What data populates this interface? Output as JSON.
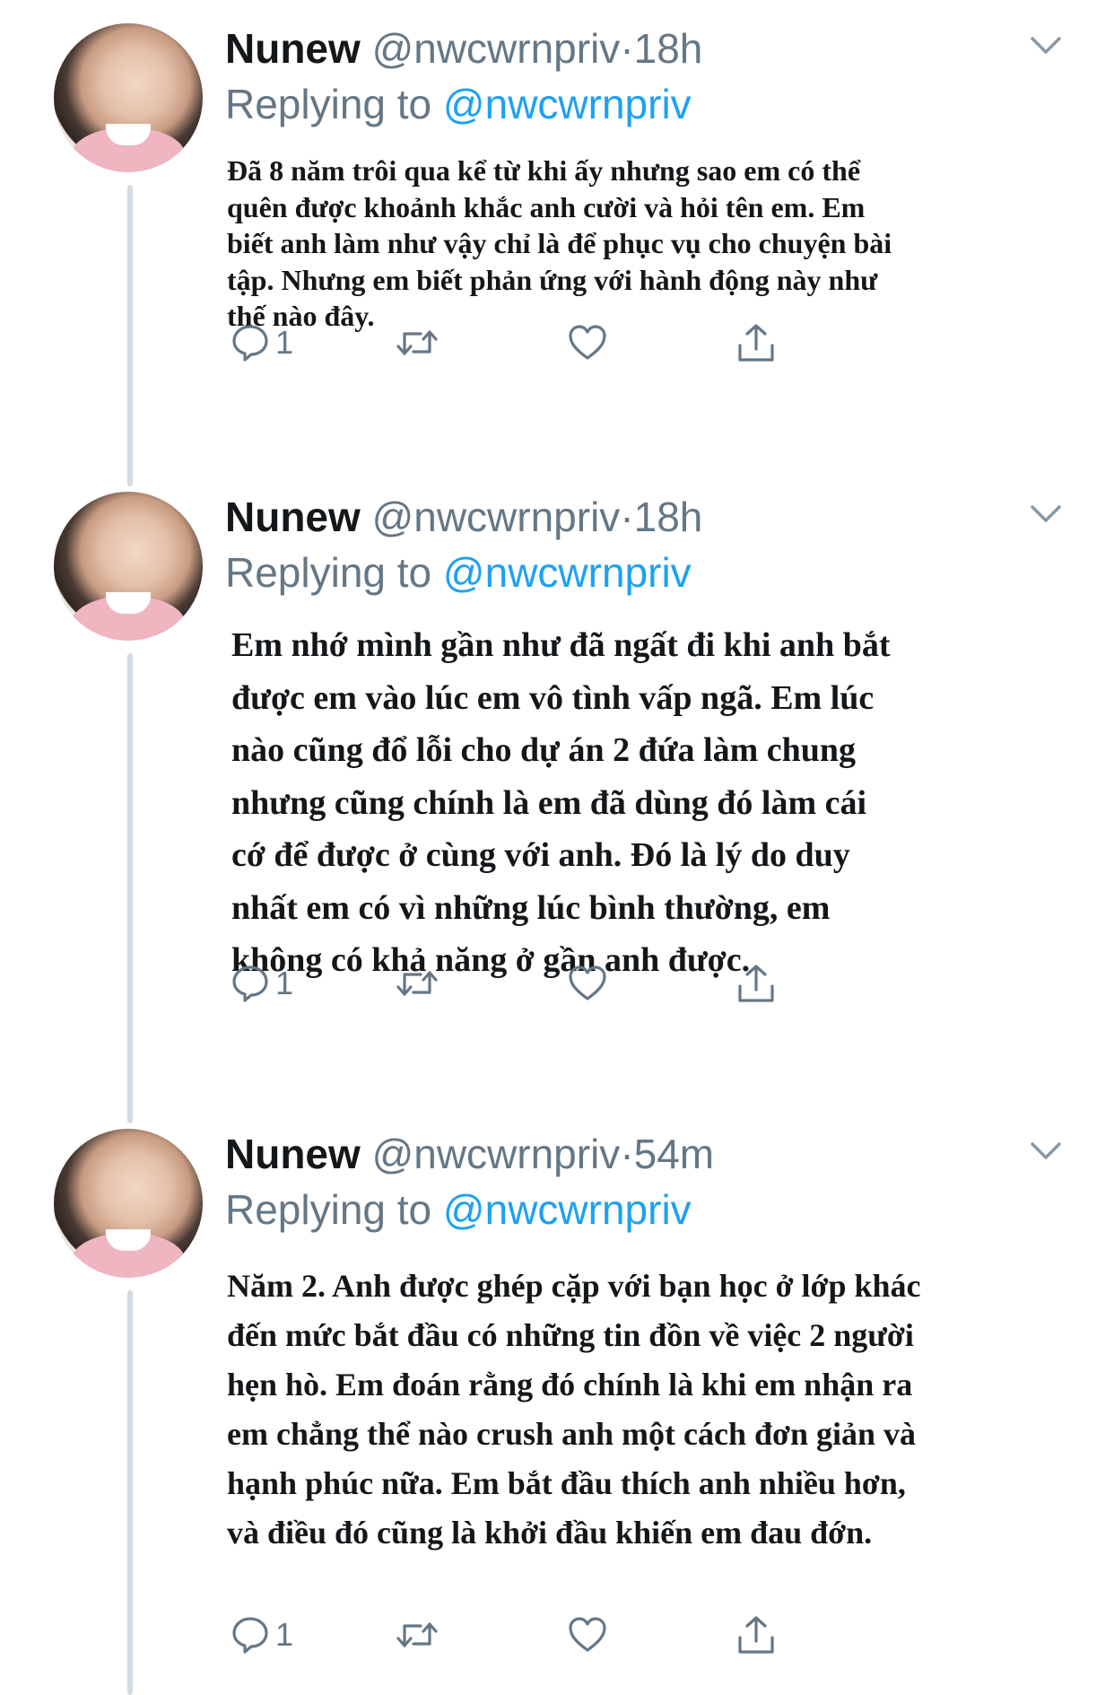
{
  "colors": {
    "name": "#14171a",
    "secondary": "#657786",
    "link": "#1da1f2",
    "thread_line": "#d4dbe0"
  },
  "tweets": [
    {
      "display_name": "Nunew",
      "handle": "@nwcwrnpriv",
      "separator": "·",
      "time": "18h",
      "replying_prefix": "Replying to",
      "replying_handle": "@nwcwrnpriv",
      "body_lines": [
        "Đã 8 năm trôi qua kể từ khi ấy nhưng sao em có thể",
        "quên được khoảnh khắc anh cười và hỏi tên em. Em",
        "biết anh làm như vậy chỉ là để phục vụ cho chuyện bài",
        "tập. Nhưng em biết phản ứng với hành động này như",
        "thế nào đây."
      ],
      "reply_count": "1",
      "icons": [
        "reply-icon",
        "retweet-icon",
        "like-icon",
        "share-icon",
        "chevron-down-icon"
      ]
    },
    {
      "display_name": "Nunew",
      "handle": "@nwcwrnpriv",
      "separator": "·",
      "time": "18h",
      "replying_prefix": "Replying to",
      "replying_handle": "@nwcwrnpriv",
      "body_lines": [
        "Em nhớ mình gần như đã ngất đi khi anh bắt",
        "được em vào lúc em vô tình vấp ngã. Em lúc",
        "nào cũng đổ lỗi cho dự án 2 đứa làm chung",
        "nhưng cũng chính là em đã dùng đó làm cái",
        "cớ để được ở cùng với anh. Đó là lý do duy",
        "nhất em có vì những lúc bình thường, em",
        "không có khả năng ở gần anh được."
      ],
      "reply_count": "1",
      "icons": [
        "reply-icon",
        "retweet-icon",
        "like-icon",
        "share-icon",
        "chevron-down-icon"
      ]
    },
    {
      "display_name": "Nunew",
      "handle": "@nwcwrnpriv",
      "separator": "·",
      "time": "54m",
      "replying_prefix": "Replying to",
      "replying_handle": "@nwcwrnpriv",
      "body_lines": [
        "Năm 2. Anh được ghép cặp với bạn học ở lớp khác",
        "đến mức bắt đầu có những tin đồn về việc 2 người",
        "hẹn hò. Em đoán rằng đó chính là khi em nhận ra",
        "em chẳng thể nào crush anh một cách đơn giản và",
        "hạnh phúc nữa. Em bắt đầu thích anh nhiều hơn,",
        "và điều đó cũng là khởi đầu khiến em đau đớn."
      ],
      "reply_count": "1",
      "icons": [
        "reply-icon",
        "retweet-icon",
        "like-icon",
        "share-icon",
        "chevron-down-icon"
      ]
    }
  ]
}
